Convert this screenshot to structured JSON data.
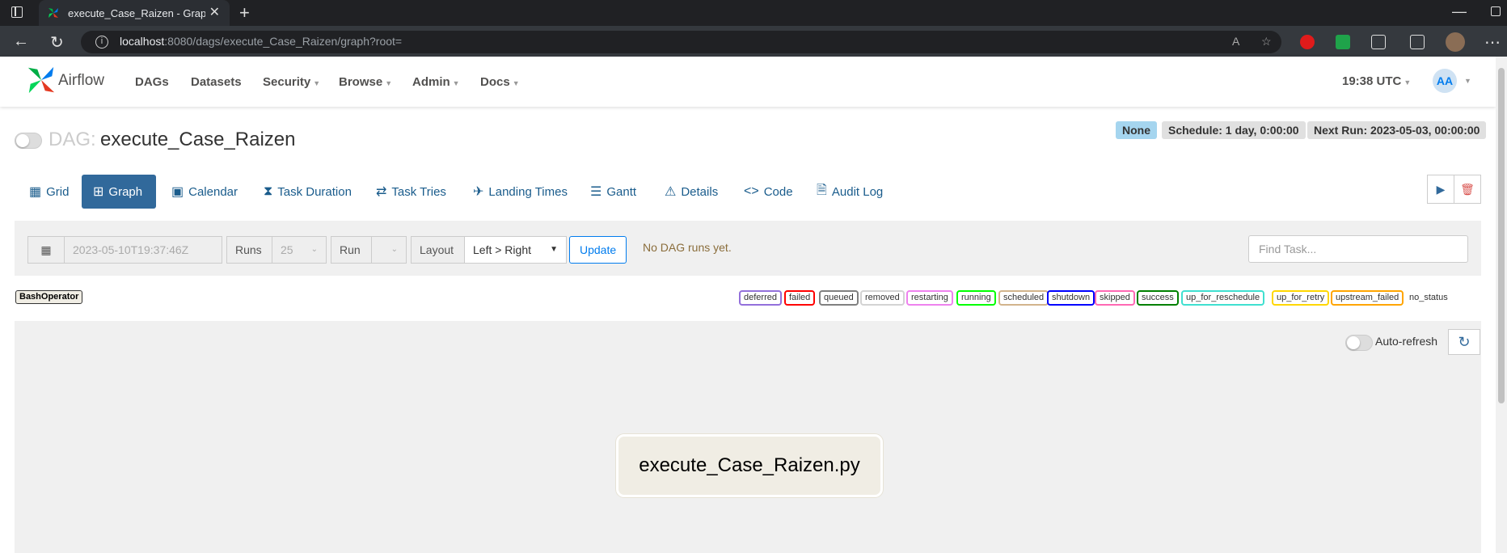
{
  "browser": {
    "tab_title": "execute_Case_Raizen - Graph - Airflow",
    "url_host": "localhost",
    "url_rest": ":8080/dags/execute_Case_Raizen/graph?root="
  },
  "navbar": {
    "brand": "Airflow",
    "items": [
      {
        "label": "DAGs"
      },
      {
        "label": "Datasets"
      },
      {
        "label": "Security"
      },
      {
        "label": "Browse"
      },
      {
        "label": "Admin"
      },
      {
        "label": "Docs"
      }
    ],
    "clock": "19:38 UTC",
    "user_initials": "AA"
  },
  "dag": {
    "prefix": "DAG:",
    "name": "execute_Case_Raizen",
    "badges": {
      "state": "None",
      "schedule": "Schedule: 1 day, 0:00:00",
      "next_run": "Next Run: 2023-05-03, 00:00:00"
    }
  },
  "tabs": [
    {
      "label": "Grid",
      "icon": "grid-icon"
    },
    {
      "label": "Graph",
      "icon": "graph-icon"
    },
    {
      "label": "Calendar",
      "icon": "calendar-icon"
    },
    {
      "label": "Task Duration",
      "icon": "hourglass-icon"
    },
    {
      "label": "Task Tries",
      "icon": "repeat-icon"
    },
    {
      "label": "Landing Times",
      "icon": "plane-landing-icon"
    },
    {
      "label": "Gantt",
      "icon": "gantt-icon"
    },
    {
      "label": "Details",
      "icon": "warning-triangle-icon"
    },
    {
      "label": "Code",
      "icon": "code-icon"
    },
    {
      "label": "Audit Log",
      "icon": "file-search-icon"
    }
  ],
  "filters": {
    "base_date_placeholder": "2023-05-10T19:37:46Z",
    "runs_label": "Runs",
    "runs_value": "25",
    "run_label": "Run",
    "run_value": "",
    "layout_label": "Layout",
    "layout_value": "Left > Right",
    "update_label": "Update",
    "no_runs_message": "No DAG runs yet.",
    "find_task_placeholder": "Find Task..."
  },
  "operator_badge": "BashOperator",
  "legend": [
    {
      "label": "deferred",
      "color": "#9370db"
    },
    {
      "label": "failed",
      "color": "#ff0000"
    },
    {
      "label": "queued",
      "color": "#808080"
    },
    {
      "label": "removed",
      "color": "#d3d3d3"
    },
    {
      "label": "restarting",
      "color": "#ee82ee"
    },
    {
      "label": "running",
      "color": "#00ff00"
    },
    {
      "label": "scheduled",
      "color": "#d2b48c"
    },
    {
      "label": "shutdown",
      "color": "#0000ff"
    },
    {
      "label": "skipped",
      "color": "#ff69b4"
    },
    {
      "label": "success",
      "color": "#008000"
    },
    {
      "label": "up_for_reschedule",
      "color": "#40e0d0"
    },
    {
      "label": "up_for_retry",
      "color": "#ffd700"
    },
    {
      "label": "upstream_failed",
      "color": "#ffa500"
    }
  ],
  "no_status_label": "no_status",
  "graph": {
    "auto_refresh_label": "Auto-refresh",
    "node_label": "execute_Case_Raizen.py"
  }
}
